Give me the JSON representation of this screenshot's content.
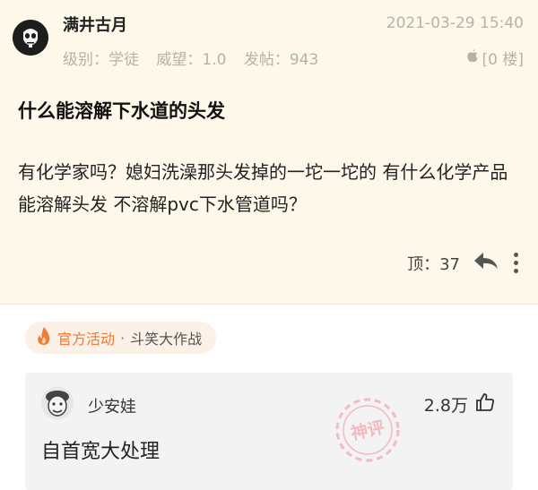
{
  "post": {
    "username": "满井古月",
    "timestamp": "2021-03-29 15:40",
    "level": "级别：学徒",
    "reputation": "威望：1.0",
    "post_count": "发帖：943",
    "floor": "[0 楼]",
    "title": "什么能溶解下水道的头发",
    "content": "有化学家吗？媳妇洗澡那头发掉的一坨一坨的 有什么化学产品能溶解头发 不溶解pvc下水管道吗？",
    "top_count": "顶：37"
  },
  "activity": {
    "official": "官方活动",
    "separator": "·",
    "event": "斗笑大作战"
  },
  "comment": {
    "username": "少安娃",
    "likes": "2.8万",
    "text": "自首宽大处理",
    "stamp_text": "神评"
  },
  "colors": {
    "post_bg": "#fdf8ea",
    "accent_orange": "#f07a37",
    "stamp_pink": "#f08a9a",
    "muted": "#b8b2a4"
  },
  "icons": {
    "avatar": "punisher-skull-avatar",
    "floor": "apple-icon",
    "reply": "reply-arrow-icon",
    "more": "more-vertical-icon",
    "fire": "fire-icon",
    "like": "thumbs-up-icon"
  }
}
